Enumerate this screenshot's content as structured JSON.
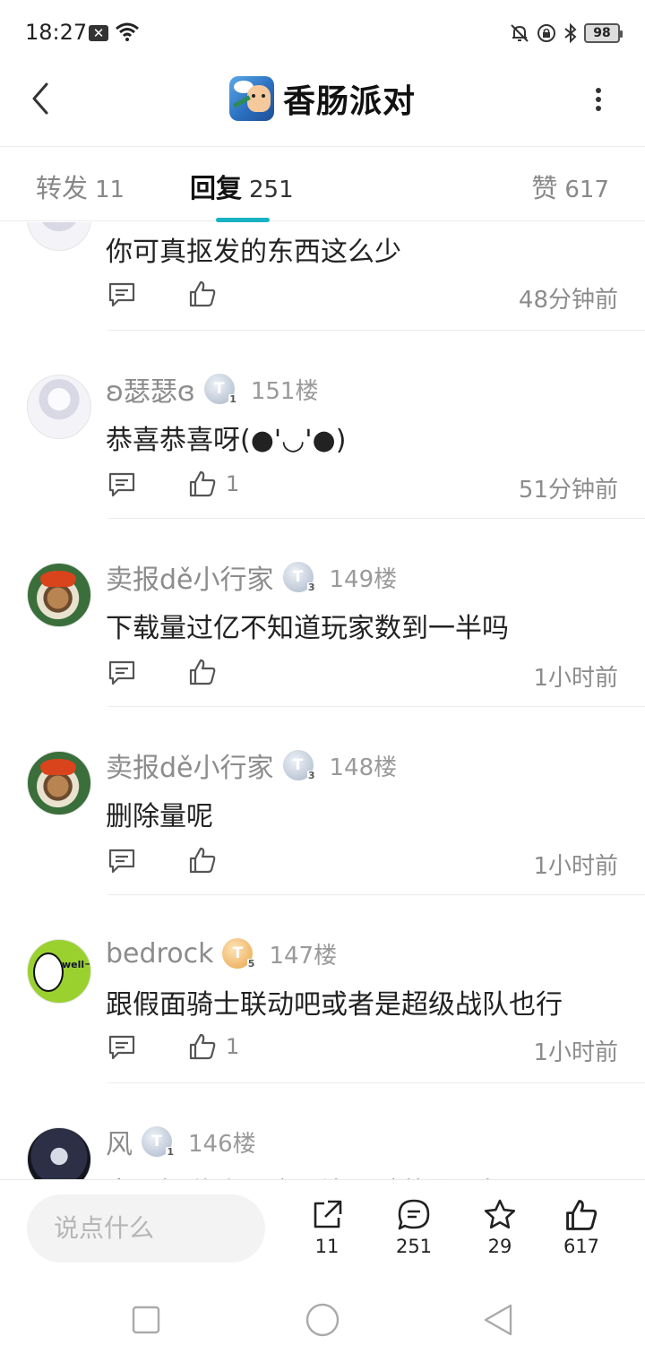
{
  "status_bar": {
    "time": "18:27",
    "battery": "98"
  },
  "header": {
    "title": "香肠派对"
  },
  "tabs": [
    {
      "label": "转发",
      "count": "11"
    },
    {
      "label": "回复",
      "count": "251"
    },
    {
      "label": "赞",
      "count": "617"
    }
  ],
  "comments": [
    {
      "text": "你可真抠发的东西这么少",
      "time": "48分钟前",
      "likes": ""
    },
    {
      "user": "ʚ瑟瑟ɞ",
      "level": "1",
      "floor": "151楼",
      "text": "恭喜恭喜呀(●'◡'●)",
      "likes": "1",
      "time": "51分钟前"
    },
    {
      "user": "卖报dě小行家",
      "level": "3",
      "floor": "149楼",
      "text": "下载量过亿不知道玩家数到一半吗",
      "likes": "",
      "time": "1小时前"
    },
    {
      "user": "卖报dě小行家",
      "level": "3",
      "floor": "148楼",
      "text": "删除量呢",
      "likes": "",
      "time": "1小时前"
    },
    {
      "user": "bedrock",
      "level": "5",
      "floor": "147楼",
      "text": "跟假面骑士联动吧或者是超级战队也行",
      "likes": "1",
      "time": "1小时前"
    },
    {
      "user": "风",
      "level": "1",
      "floor": "146楼",
      "text": "良心好游戏，这不比隔壁的和平好吗，没",
      "likes": "",
      "time": ""
    }
  ],
  "bottom_bar": {
    "placeholder": "说点什么",
    "repost_count": "11",
    "comment_count": "251",
    "favorite_count": "29",
    "like_count": "617"
  },
  "colors": {
    "accent": "#18b3c3",
    "muted_text": "#8c8c8c"
  }
}
